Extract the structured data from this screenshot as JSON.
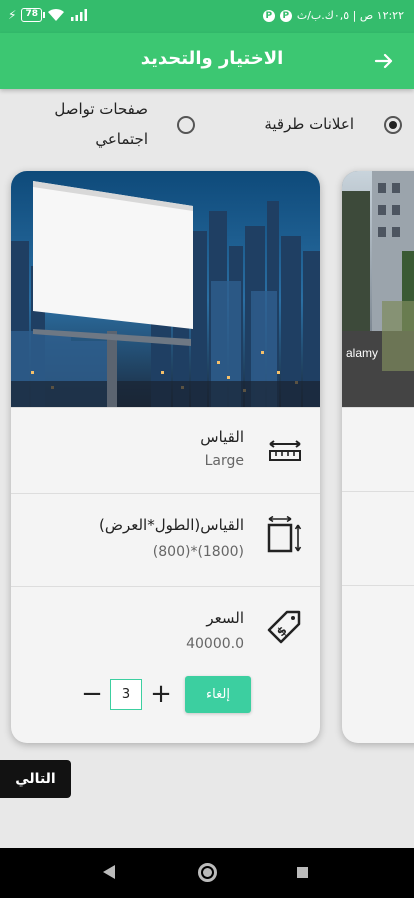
{
  "status": {
    "battery": "78",
    "time_text": "١٢:٢٢ ص | ٠,٥ك.ب/ث"
  },
  "header": {
    "title": "الاختيار والتحديد"
  },
  "options": {
    "billboards_label": "اعلانات طرقية",
    "social_label_line1": "صفحات تواصل",
    "social_label_line2": "اجتماعي",
    "selected": "billboards"
  },
  "card": {
    "size_title": "القياس",
    "size_value": "Large",
    "dims_title": "القياس(الطول*العرض)",
    "dims_value": "(800)*(1800)",
    "price_title": "السعر",
    "price_value": "40000.0",
    "cancel_label": "إلغاء",
    "quantity": "3",
    "plus": "+",
    "minus": "−"
  },
  "side_card": {
    "watermark": "alamy"
  },
  "footer": {
    "next_label": "التالي"
  },
  "colors": {
    "accent": "#3cc772",
    "button": "#3ccfa0"
  }
}
